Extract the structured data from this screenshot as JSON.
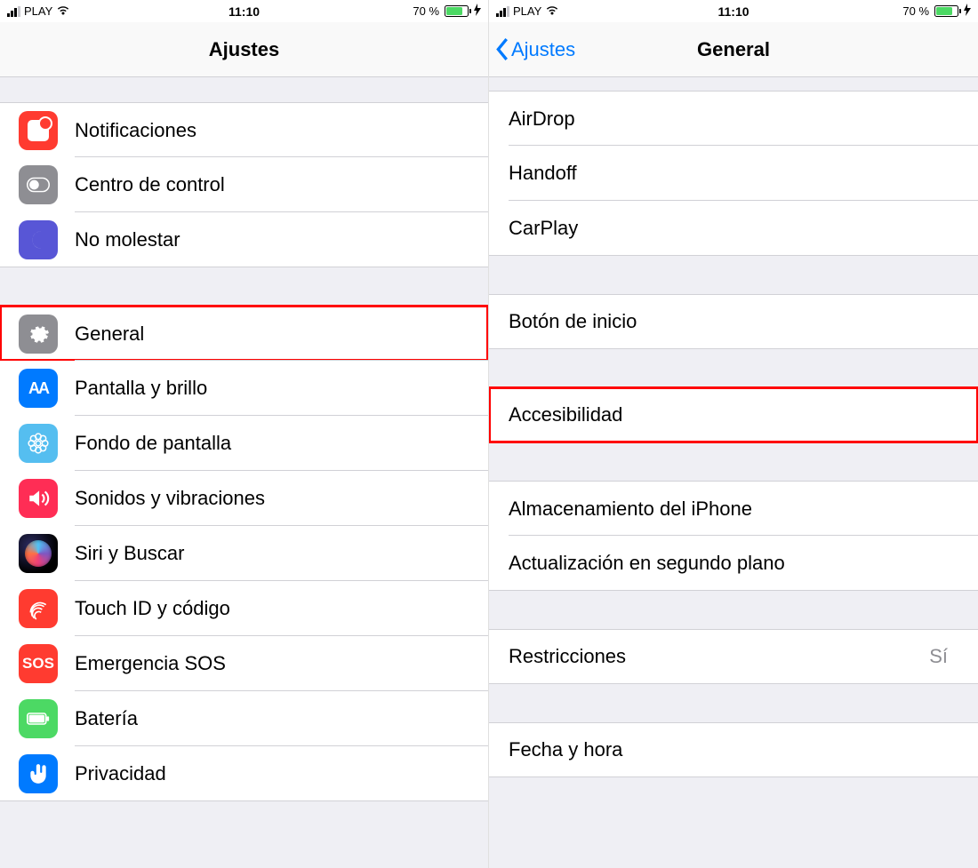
{
  "statusbar": {
    "carrier": "PLAY",
    "time": "11:10",
    "battery_pct": "70 %"
  },
  "left": {
    "title": "Ajustes",
    "items": [
      {
        "label": "Notificaciones"
      },
      {
        "label": "Centro de control"
      },
      {
        "label": "No molestar"
      },
      {
        "label": "General",
        "highlight": true
      },
      {
        "label": "Pantalla y brillo"
      },
      {
        "label": "Fondo de pantalla"
      },
      {
        "label": "Sonidos y vibraciones"
      },
      {
        "label": "Siri y Buscar"
      },
      {
        "label": "Touch ID y código"
      },
      {
        "label": "Emergencia SOS"
      },
      {
        "label": "Batería"
      },
      {
        "label": "Privacidad"
      }
    ],
    "sos_text": "SOS",
    "aa_text": "AA"
  },
  "right": {
    "back_label": "Ajustes",
    "title": "General",
    "groups": [
      [
        {
          "label": "AirDrop"
        },
        {
          "label": "Handoff"
        },
        {
          "label": "CarPlay"
        }
      ],
      [
        {
          "label": "Botón de inicio"
        }
      ],
      [
        {
          "label": "Accesibilidad",
          "highlight": true
        }
      ],
      [
        {
          "label": "Almacenamiento del iPhone"
        },
        {
          "label": "Actualización en segundo plano"
        }
      ],
      [
        {
          "label": "Restricciones",
          "value": "Sí"
        }
      ],
      [
        {
          "label": "Fecha y hora"
        }
      ]
    ]
  }
}
